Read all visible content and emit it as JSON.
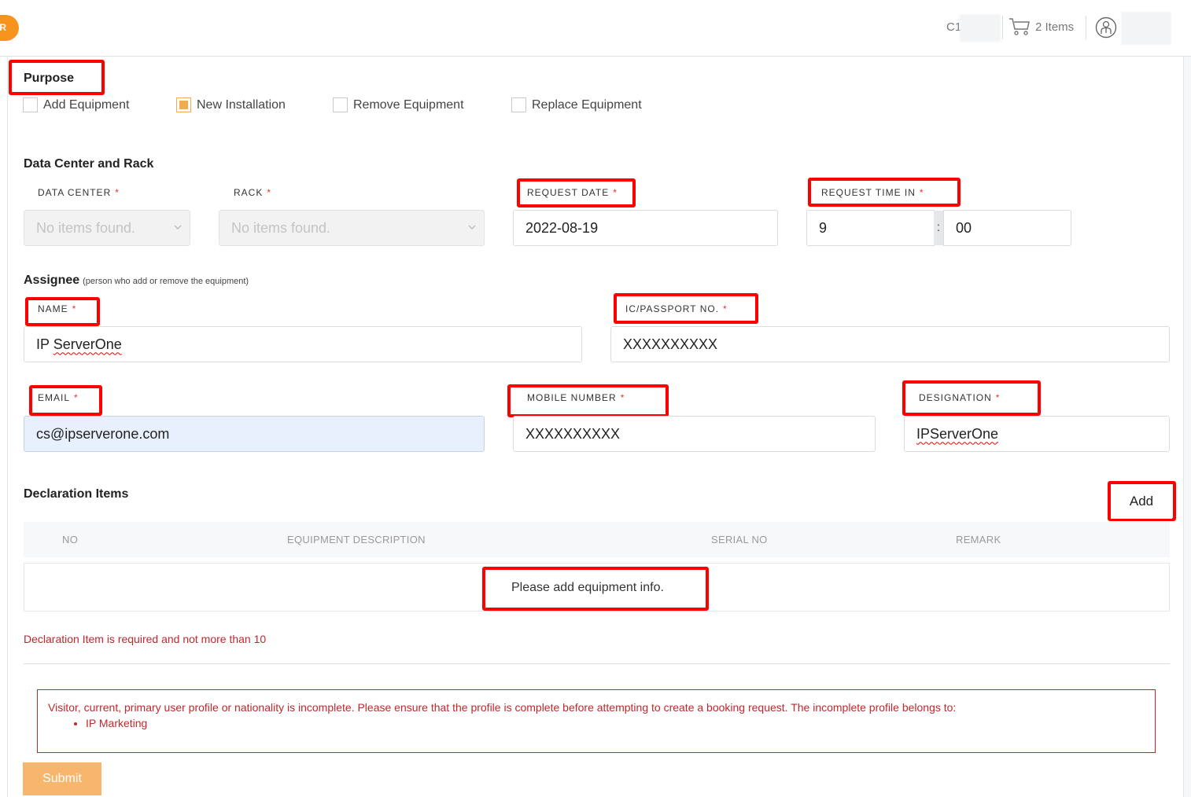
{
  "header": {
    "logo_letter": "R",
    "account_code": "C1",
    "cart": {
      "icon": "cart-icon",
      "label": "2 Items"
    },
    "user_icon": "user-profile-icon"
  },
  "purpose": {
    "title": "Purpose",
    "options": [
      {
        "label": "Add Equipment",
        "checked": false
      },
      {
        "label": "New Installation",
        "checked": true
      },
      {
        "label": "Remove Equipment",
        "checked": false
      },
      {
        "label": "Replace Equipment",
        "checked": false
      }
    ]
  },
  "datacenter": {
    "title": "Data Center and Rack",
    "data_center": {
      "label": "DATA CENTER",
      "placeholder": "No items found."
    },
    "rack": {
      "label": "RACK",
      "placeholder": "No items found."
    },
    "request_date": {
      "label": "REQUEST DATE",
      "value": "2022-08-19"
    },
    "request_time": {
      "label": "REQUEST TIME IN",
      "hour": "9",
      "separator": ":",
      "minute": "00"
    },
    "required_mark": "*"
  },
  "assignee": {
    "title": "Assignee",
    "note": "(person who add or remove the equipment)",
    "name": {
      "label": "NAME",
      "value": "IP ServerOne"
    },
    "ic_passport": {
      "label": "IC/PASSPORT NO.",
      "value": "XXXXXXXXXX"
    },
    "email": {
      "label": "EMAIL",
      "value": "cs@ipserverone.com"
    },
    "mobile": {
      "label": "MOBILE NUMBER",
      "value": "XXXXXXXXXX"
    },
    "designation": {
      "label": "DESIGNATION",
      "value": "IPServerOne"
    }
  },
  "declaration": {
    "title": "Declaration Items",
    "add_label": "Add",
    "columns": [
      "NO",
      "EQUIPMENT DESCRIPTION",
      "SERIAL NO",
      "REMARK"
    ],
    "rows": [],
    "empty_message": "Please add equipment info.",
    "validation_error": "Declaration Item is required and not more than 10"
  },
  "alert": {
    "message": "Visitor, current, primary user profile or nationality is incomplete. Please ensure that the profile is complete before attempting to create a booking request. The incomplete profile belongs to:",
    "items": [
      "IP Marketing"
    ]
  },
  "submit_label": "Submit",
  "colors": {
    "brand_orange": "#f7941d",
    "checkbox_accent": "#f0ad4e",
    "error_red": "#c0282d",
    "highlight_red": "#ff0000",
    "submit_disabled": "#f8b56c"
  }
}
